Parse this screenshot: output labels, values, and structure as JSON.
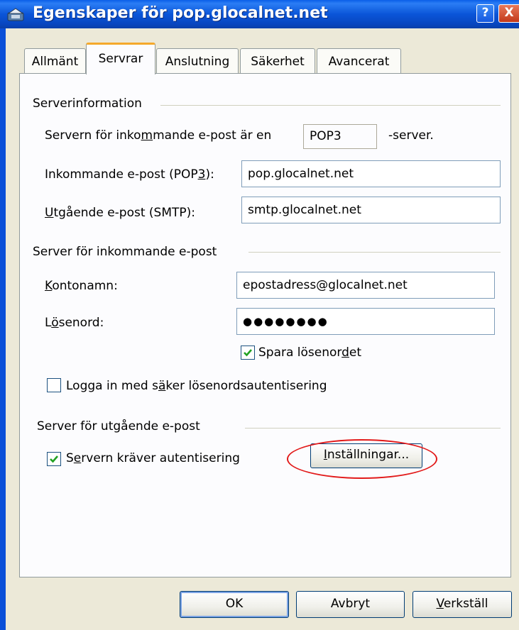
{
  "window": {
    "title": "Egenskaper för pop.glocalnet.net",
    "help_label": "?",
    "close_label": "X"
  },
  "tabs": [
    {
      "label": "Allmänt",
      "active": false
    },
    {
      "label": "Servrar",
      "active": true
    },
    {
      "label": "Anslutning",
      "active": false
    },
    {
      "label": "Säkerhet",
      "active": false
    },
    {
      "label": "Avancerat",
      "active": false
    }
  ],
  "server_info": {
    "group_title": "Serverinformation",
    "incoming_type_prefix": "Servern för inkommande e-post är en",
    "incoming_type_value": "POP3",
    "incoming_type_suffix": "-server.",
    "incoming_label": "Inkommande e-post (POP3):",
    "incoming_value": "pop.glocalnet.net",
    "outgoing_label": "Utgående e-post (SMTP):",
    "outgoing_value": "smtp.glocalnet.net"
  },
  "incoming_server": {
    "group_title": "Server för inkommande e-post",
    "account_label": "Kontonamn:",
    "account_value": "epostadress@glocalnet.net",
    "password_label": "Lösenord:",
    "password_value": "●●●●●●●●",
    "save_password_label": "Spara lösenordet",
    "save_password_checked": true,
    "secure_auth_label": "Logga in med säker lösenordsautentisering",
    "secure_auth_checked": false
  },
  "outgoing_server": {
    "group_title": "Server för utgående e-post",
    "requires_auth_label": "Servern kräver autentisering",
    "requires_auth_checked": true,
    "settings_button": "Inställningar..."
  },
  "footer": {
    "ok": "OK",
    "cancel": "Avbryt",
    "apply": "Verkställ"
  },
  "colors": {
    "titlebar": "#0a55d8",
    "highlight": "#e21a1a",
    "checkmark": "#21a121"
  }
}
